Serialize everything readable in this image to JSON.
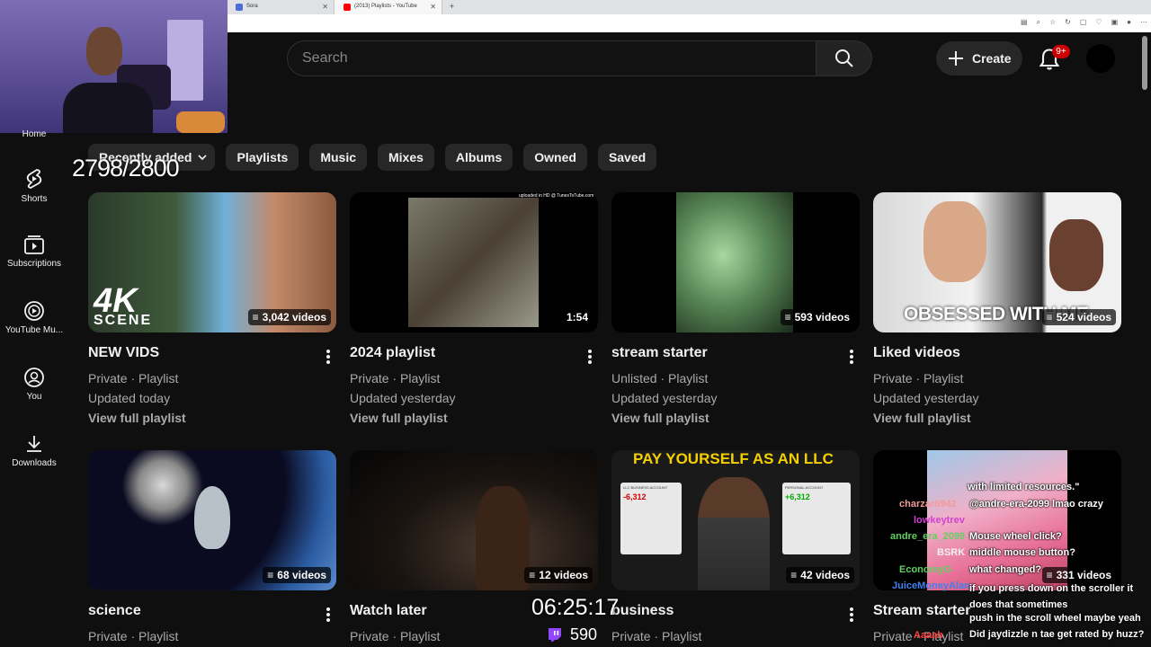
{
  "browser": {
    "tabs": [
      {
        "label": "Sora",
        "active": false
      },
      {
        "label": "(2013) Playlists - YouTube",
        "active": true
      }
    ],
    "new_tab": "+"
  },
  "header": {
    "search_placeholder": "Search",
    "create_label": "Create",
    "notifications_badge": "9+"
  },
  "sidebar": {
    "items": [
      {
        "label": "Home",
        "icon": "home-icon"
      },
      {
        "label": "Shorts",
        "icon": "shorts-icon"
      },
      {
        "label": "Subscriptions",
        "icon": "subscriptions-icon"
      },
      {
        "label": "YouTube Mu...",
        "icon": "youtube-music-icon"
      },
      {
        "label": "You",
        "icon": "you-icon"
      },
      {
        "label": "Downloads",
        "icon": "downloads-icon"
      }
    ]
  },
  "chips": {
    "sort_label": "Recently added",
    "filters": [
      "Playlists",
      "Music",
      "Mixes",
      "Albums",
      "Owned",
      "Saved"
    ]
  },
  "overlay": {
    "counter": "2798/2800",
    "timer": "06:25:17",
    "viewers": "590"
  },
  "playlists": [
    {
      "title": "NEW VIDS",
      "privacy": "Private · Playlist",
      "updated": "Updated today",
      "link": "View full playlist",
      "count": "3,042 videos",
      "thumb_text": "4K",
      "thumb_text2": "SCENE"
    },
    {
      "title": "2024 playlist",
      "privacy": "Private · Playlist",
      "updated": "Updated yesterday",
      "link": "View full playlist",
      "count": "1:54",
      "thumb_text": "uploaded in HD @ TunesToTube.com"
    },
    {
      "title": "stream starter",
      "privacy": "Unlisted · Playlist",
      "updated": "Updated yesterday",
      "link": "View full playlist",
      "count": "593 videos"
    },
    {
      "title": "Liked videos",
      "privacy": "Private · Playlist",
      "updated": "Updated yesterday",
      "link": "View full playlist",
      "count": "524 videos",
      "thumb_text": "OBSESSED WITH ME"
    },
    {
      "title": "science",
      "privacy": "Private · Playlist",
      "count": "68 videos"
    },
    {
      "title": "Watch later",
      "privacy": "Private · Playlist",
      "count": "12 videos"
    },
    {
      "title": "business",
      "privacy": "Private · Playlist",
      "count": "42 videos",
      "thumb_text": "PAY YOURSELF AS AN LLC",
      "thumb_text2": "LLC BUSINESS ACCOUNT",
      "thumb_text3": "-6,312",
      "thumb_text4": "PERSONAL ACCOUNT",
      "thumb_text5": "+6,312"
    },
    {
      "title": "Stream starter",
      "privacy": "Private · Playlist",
      "count": "331 videos"
    }
  ],
  "chat": {
    "messages": [
      {
        "user": "charzar6942",
        "text": "with limited resources.\""
      },
      {
        "user": "",
        "text": "@andre-era-2099 lmao crazy"
      },
      {
        "user": "lowkeytrev",
        "text": ""
      },
      {
        "user": "andre_era_2099",
        "text": "Mouse wheel click?"
      },
      {
        "user": "BSRK",
        "text": "middle mouse button?"
      },
      {
        "user": "EconomyG",
        "text": "what changed?"
      },
      {
        "user": "JuiceMoneyAlan",
        "text": "if you press down on the scroller it does that sometimes"
      },
      {
        "user": "",
        "text": "push in the scroll wheel maybe yeah"
      },
      {
        "user": "Aaaah",
        "text": "Did jaydizzle n tae get rated by huzz?"
      }
    ]
  },
  "colors": {
    "background": "#0f0f0f",
    "chip": "#272727",
    "badge": "#cc0000",
    "secondary_text": "#aaaaaa"
  }
}
